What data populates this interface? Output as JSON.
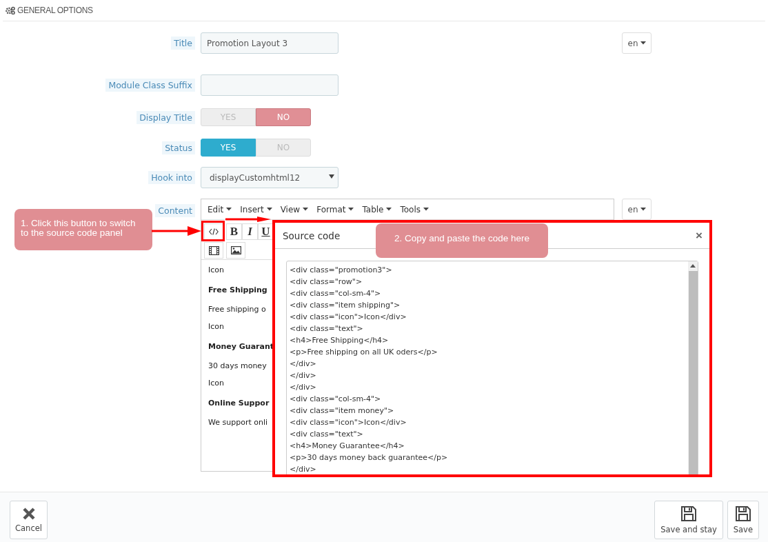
{
  "header": {
    "title": "GENERAL OPTIONS"
  },
  "fields": [
    {
      "kind": "text",
      "label": "Title",
      "value": "Promotion Layout 3",
      "language": "en"
    },
    {
      "kind": "text",
      "label": "Module Class Suffix"
    },
    {
      "kind": "switch",
      "label": "Display Title",
      "options": [
        {
          "label": "YES",
          "selected": false
        },
        {
          "label": "NO",
          "selected": true
        }
      ]
    },
    {
      "kind": "switch",
      "label": "Status",
      "options": [
        {
          "label": "YES",
          "selected": true
        },
        {
          "label": "NO",
          "selected": false
        }
      ]
    },
    {
      "kind": "select",
      "label": "Hook into",
      "value": "displayCustomhtml12"
    }
  ],
  "content": {
    "label": "Content",
    "language": "en",
    "menus": [
      "Edit",
      "Insert",
      "View",
      "Format",
      "Table",
      "Tools"
    ],
    "format_buttons": [
      "B",
      "I",
      "U"
    ],
    "body": [
      {
        "kind": "text",
        "text": "Icon"
      },
      {
        "kind": "heading",
        "text": "Free Shipping"
      },
      {
        "kind": "text",
        "text": "Free shipping o"
      },
      {
        "kind": "text",
        "text": "Icon"
      },
      {
        "kind": "heading",
        "text": "Money Guarant"
      },
      {
        "kind": "text",
        "text": "30 days money"
      },
      {
        "kind": "text",
        "text": "Icon"
      },
      {
        "kind": "heading",
        "text": "Online Suppor"
      },
      {
        "kind": "text",
        "text": "We support onli"
      }
    ]
  },
  "source_dialog": {
    "title": "Source code",
    "close": "×",
    "code_lines": [
      "<div class=\"promotion3\">",
      "<div class=\"row\">",
      "<div class=\"col-sm-4\">",
      "<div class=\"item shipping\">",
      "<div class=\"icon\">Icon</div>",
      "<div class=\"text\">",
      "<h4>Free Shipping</h4>",
      "<p>Free shipping on all UK oders</p>",
      "</div>",
      "</div>",
      "</div>",
      "<div class=\"col-sm-4\">",
      "<div class=\"item money\">",
      "<div class=\"icon\">Icon</div>",
      "<div class=\"text\">",
      "<h4>Money Guarantee</h4>",
      "<p>30 days money back guarantee</p>",
      "</div>"
    ]
  },
  "annotations": [
    "1. Click this button to switch to the source code panel",
    "2. Copy and paste the code here"
  ],
  "footer": {
    "buttons": [
      {
        "kind": "cancel",
        "label": "Cancel"
      },
      {
        "kind": "save",
        "label": "Save and stay"
      },
      {
        "kind": "save",
        "label": "Save"
      }
    ]
  }
}
